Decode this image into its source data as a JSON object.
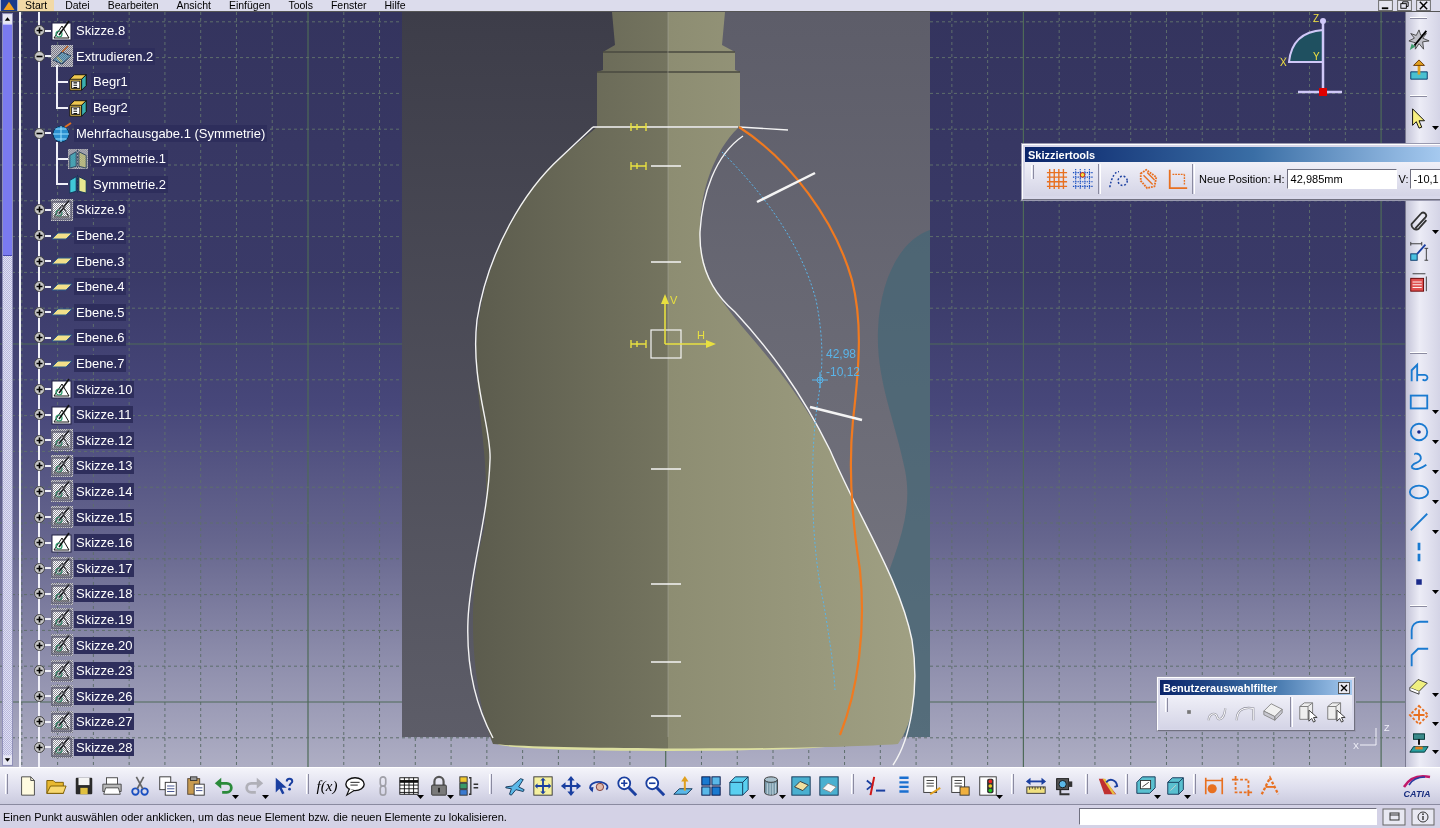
{
  "menu_bar": {
    "items": [
      {
        "label": "Start",
        "selected": true
      },
      {
        "label": "Datei",
        "selected": false
      },
      {
        "label": "Bearbeiten",
        "selected": false
      },
      {
        "label": "Ansicht",
        "selected": false
      },
      {
        "label": "Einfügen",
        "selected": false
      },
      {
        "label": "Tools",
        "selected": false
      },
      {
        "label": "Fenster",
        "selected": false
      },
      {
        "label": "Hilfe",
        "selected": false
      }
    ]
  },
  "tree": {
    "items": [
      {
        "label": "Skizze.8",
        "kind": "sketch",
        "hidden": false,
        "expanded": false
      },
      {
        "label": "Extrudieren.2",
        "kind": "extrude",
        "hidden": true,
        "expanded": true,
        "children": [
          {
            "label": "Begr1",
            "kind": "limit",
            "hidden": false
          },
          {
            "label": "Begr2",
            "kind": "limit",
            "hidden": false
          }
        ]
      },
      {
        "label": "Mehrfachausgabe.1 (Symmetrie)",
        "kind": "multi_output",
        "hidden": false,
        "expanded": true,
        "children": [
          {
            "label": "Symmetrie.1",
            "kind": "symmetry",
            "hidden": true
          },
          {
            "label": "Symmetrie.2",
            "kind": "symmetry",
            "hidden": false
          }
        ]
      },
      {
        "label": "Skizze.9",
        "kind": "sketch",
        "hidden": true,
        "expanded": false
      },
      {
        "label": "Ebene.2",
        "kind": "plane",
        "hidden": false,
        "expanded": false
      },
      {
        "label": "Ebene.3",
        "kind": "plane",
        "hidden": false,
        "expanded": false
      },
      {
        "label": "Ebene.4",
        "kind": "plane",
        "hidden": false,
        "expanded": false
      },
      {
        "label": "Ebene.5",
        "kind": "plane",
        "hidden": false,
        "expanded": false
      },
      {
        "label": "Ebene.6",
        "kind": "plane",
        "hidden": false,
        "expanded": false
      },
      {
        "label": "Ebene.7",
        "kind": "plane",
        "hidden": false,
        "expanded": false
      },
      {
        "label": "Skizze.10",
        "kind": "sketch",
        "hidden": false,
        "expanded": false
      },
      {
        "label": "Skizze.11",
        "kind": "sketch",
        "hidden": false,
        "expanded": false
      },
      {
        "label": "Skizze.12",
        "kind": "sketch",
        "hidden": true,
        "expanded": false
      },
      {
        "label": "Skizze.13",
        "kind": "sketch",
        "hidden": true,
        "expanded": false
      },
      {
        "label": "Skizze.14",
        "kind": "sketch",
        "hidden": true,
        "expanded": false
      },
      {
        "label": "Skizze.15",
        "kind": "sketch",
        "hidden": true,
        "expanded": false
      },
      {
        "label": "Skizze.16",
        "kind": "sketch",
        "hidden": false,
        "expanded": false
      },
      {
        "label": "Skizze.17",
        "kind": "sketch",
        "hidden": true,
        "expanded": false
      },
      {
        "label": "Skizze.18",
        "kind": "sketch",
        "hidden": true,
        "expanded": false
      },
      {
        "label": "Skizze.19",
        "kind": "sketch",
        "hidden": true,
        "expanded": false
      },
      {
        "label": "Skizze.20",
        "kind": "sketch",
        "hidden": true,
        "expanded": false
      },
      {
        "label": "Skizze.23",
        "kind": "sketch",
        "hidden": true,
        "expanded": false
      },
      {
        "label": "Skizze.26",
        "kind": "sketch",
        "hidden": true,
        "expanded": false
      },
      {
        "label": "Skizze.27",
        "kind": "sketch",
        "hidden": true,
        "expanded": false
      },
      {
        "label": "Skizze.28",
        "kind": "sketch",
        "hidden": true,
        "expanded": false
      }
    ]
  },
  "viewport": {
    "axis_labels": {
      "h": "H",
      "v": "V"
    },
    "cursor_readout": {
      "h": "42,98",
      "v": "-10,12"
    },
    "compass_axes": {
      "z": "Z",
      "x": "X",
      "y": "Y"
    },
    "triad_axes": {
      "z": "Z",
      "x": "X"
    }
  },
  "sketch_tools": {
    "title": "Skizziertools",
    "position_label": "Neue Position: H:",
    "h_value": "42,985mm",
    "v_label": "V:",
    "v_value": "-10,1"
  },
  "selection_filter": {
    "title": "Benutzerauswahlfilter"
  },
  "bottom_toolbar": {
    "formula_label": "f(x)",
    "logo_text": "CATIA"
  },
  "status_bar": {
    "message": "Einen Punkt auswählen oder anklicken, um das neue Element bzw. die neuen Elemente zu lokalisieren."
  }
}
